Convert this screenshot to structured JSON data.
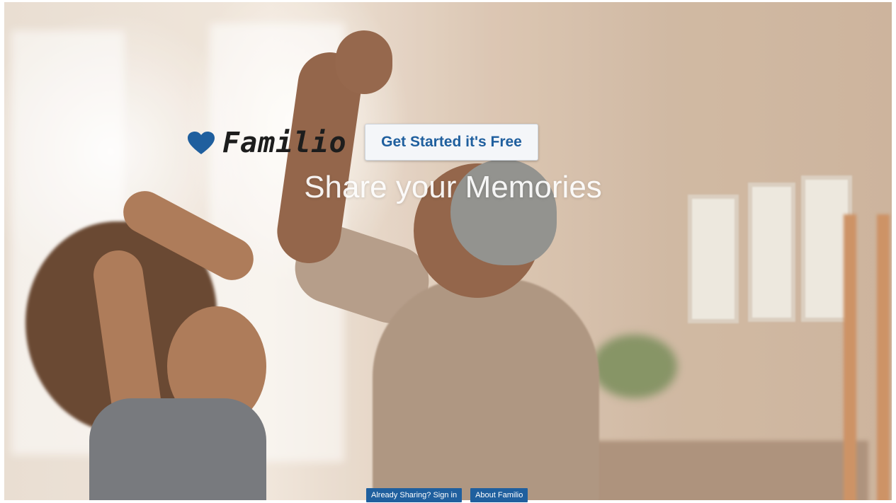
{
  "brand": {
    "logo_text": "Familio",
    "logo_icon": "heart-icon",
    "accent_color": "#1f5f9e"
  },
  "hero": {
    "cta_label": "Get Started it's Free",
    "tagline": "Share your Memories"
  },
  "footer": {
    "sign_in_label": "Already Sharing? Sign in",
    "about_label": "About Familio"
  }
}
